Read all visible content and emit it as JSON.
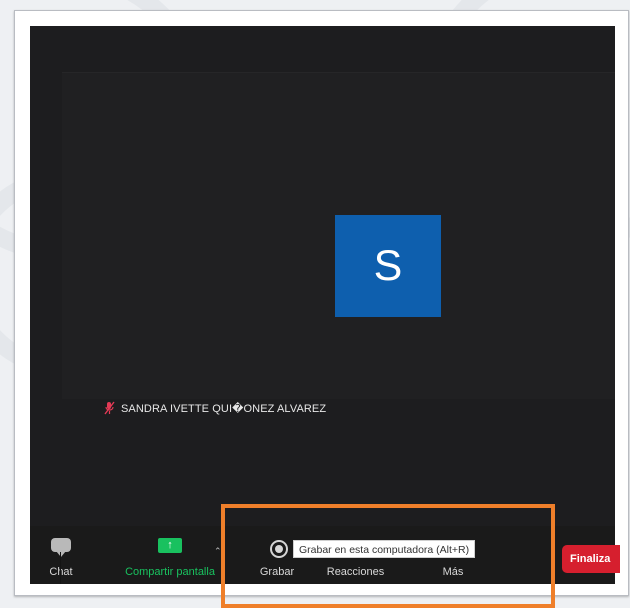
{
  "participant": {
    "avatar_initial": "S",
    "name": "SANDRA IVETTE QUI�ONEZ ALVAREZ"
  },
  "toolbar": {
    "chat_label": "Chat",
    "share_label": "Compartir pantalla",
    "record_label": "Grabar",
    "reactions_label": "Reacciones",
    "more_label": "Más",
    "end_label": "Finaliza"
  },
  "tooltip": {
    "text": "Grabar en esta computadora (Alt+R)"
  },
  "icons": {
    "mic": "mic-muted-icon",
    "chat": "chat-icon",
    "share": "share-screen-icon",
    "record": "record-icon",
    "share_caret": "chevron-up-icon"
  },
  "colors": {
    "avatar": "#0e5fae",
    "share": "#19c15f",
    "end": "#d61f2e",
    "highlight": "#ef7f2a",
    "muted_mic": "#e33a55"
  }
}
